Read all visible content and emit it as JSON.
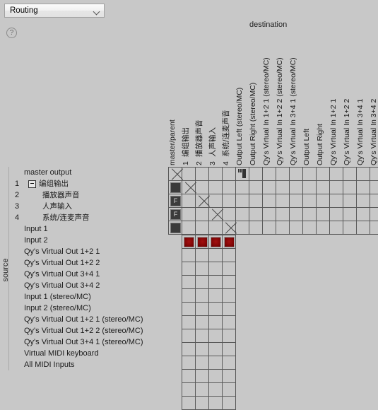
{
  "window": {
    "mode_select_value": "Routing",
    "help_icon": "question-mark-icon",
    "destination_caption": "destination",
    "source_caption": "source"
  },
  "rows": [
    {
      "num": "",
      "label": "master output",
      "indent": 0,
      "expander": false
    },
    {
      "num": "1",
      "label": "编组输出",
      "indent": 1,
      "expander": true,
      "cn": true
    },
    {
      "num": "2",
      "label": "播放器声音",
      "indent": 2,
      "expander": false,
      "cn": true
    },
    {
      "num": "3",
      "label": "人声输入",
      "indent": 2,
      "expander": false,
      "cn": true
    },
    {
      "num": "4",
      "label": "系统/连麦声音",
      "indent": 2,
      "expander": false,
      "cn": true
    },
    {
      "num": "",
      "label": "Input 1",
      "indent": 0,
      "expander": false
    },
    {
      "num": "",
      "label": "Input 2",
      "indent": 0,
      "expander": false
    },
    {
      "num": "",
      "label": "Qy's Virtual Out 1+2 1",
      "indent": 0,
      "expander": false
    },
    {
      "num": "",
      "label": "Qy's Virtual Out 1+2 2",
      "indent": 0,
      "expander": false
    },
    {
      "num": "",
      "label": "Qy's Virtual Out 3+4 1",
      "indent": 0,
      "expander": false
    },
    {
      "num": "",
      "label": "Qy's Virtual Out 3+4 2",
      "indent": 0,
      "expander": false
    },
    {
      "num": "",
      "label": "Input 1 (stereo/MC)",
      "indent": 0,
      "expander": false
    },
    {
      "num": "",
      "label": "Input 2 (stereo/MC)",
      "indent": 0,
      "expander": false
    },
    {
      "num": "",
      "label": "Qy's Virtual Out 1+2 1 (stereo/MC)",
      "indent": 0,
      "expander": false
    },
    {
      "num": "",
      "label": "Qy's Virtual Out 1+2 2 (stereo/MC)",
      "indent": 0,
      "expander": false
    },
    {
      "num": "",
      "label": "Qy's Virtual Out 3+4 1 (stereo/MC)",
      "indent": 0,
      "expander": false
    },
    {
      "num": "",
      "label": "Virtual MIDI keyboard",
      "indent": 0,
      "expander": false
    },
    {
      "num": "",
      "label": "All MIDI Inputs",
      "indent": 0,
      "expander": false
    }
  ],
  "columns": [
    {
      "num": "",
      "label": "master/parent",
      "cn": false
    },
    {
      "num": "1",
      "label": "编组输出",
      "cn": true
    },
    {
      "num": "2",
      "label": "播放器声音",
      "cn": true
    },
    {
      "num": "3",
      "label": "人声输入",
      "cn": true
    },
    {
      "num": "4",
      "label": "系统/连麦声音",
      "cn": true
    },
    {
      "num": "",
      "label": "Output Left (stereo/MC)",
      "cn": false
    },
    {
      "num": "",
      "label": "Output Right (stereo/MC)",
      "cn": false
    },
    {
      "num": "",
      "label": "Qy's Virtual In 1+2 1 (stereo/MC)",
      "cn": false
    },
    {
      "num": "",
      "label": "Qy's Virtual In 1+2 2 (stereo/MC)",
      "cn": false
    },
    {
      "num": "",
      "label": "Qy's Virtual In 3+4 1 (stereo/MC)",
      "cn": false
    },
    {
      "num": "",
      "label": "Output Left",
      "cn": false
    },
    {
      "num": "",
      "label": "Output Right",
      "cn": false
    },
    {
      "num": "",
      "label": "Qy's Virtual In 1+2 1",
      "cn": false
    },
    {
      "num": "",
      "label": "Qy's Virtual In 1+2 2",
      "cn": false
    },
    {
      "num": "",
      "label": "Qy's Virtual In 3+4 1",
      "cn": false
    },
    {
      "num": "",
      "label": "Qy's Virtual In 3+4 2",
      "cn": false
    }
  ],
  "matrix": {
    "cell_size": 19,
    "top_block_rows": 5,
    "top_block_cols": 16,
    "bottom_block_rows": 13,
    "bottom_block_col_start": 1,
    "bottom_block_cols": 4,
    "marks": [
      {
        "row": 0,
        "col": 0,
        "type": "x"
      },
      {
        "row": 1,
        "col": 0,
        "type": "dark"
      },
      {
        "row": 1,
        "col": 1,
        "type": "x"
      },
      {
        "row": 2,
        "col": 0,
        "type": "dark",
        "text": "F"
      },
      {
        "row": 2,
        "col": 2,
        "type": "x"
      },
      {
        "row": 3,
        "col": 0,
        "type": "dark",
        "text": "F"
      },
      {
        "row": 3,
        "col": 3,
        "type": "x"
      },
      {
        "row": 4,
        "col": 0,
        "type": "dark"
      },
      {
        "row": 4,
        "col": 4,
        "type": "x"
      },
      {
        "row": 0,
        "col": 5,
        "type": "monitor"
      },
      {
        "row": 5,
        "col": 1,
        "type": "red"
      },
      {
        "row": 5,
        "col": 2,
        "type": "red"
      },
      {
        "row": 5,
        "col": 3,
        "type": "red"
      },
      {
        "row": 5,
        "col": 4,
        "type": "red"
      }
    ]
  },
  "colors": {
    "background": "#c8c8c8",
    "grid_line": "#595959",
    "active_red": "#8a0808",
    "button_dark": "#3b3b3b"
  }
}
